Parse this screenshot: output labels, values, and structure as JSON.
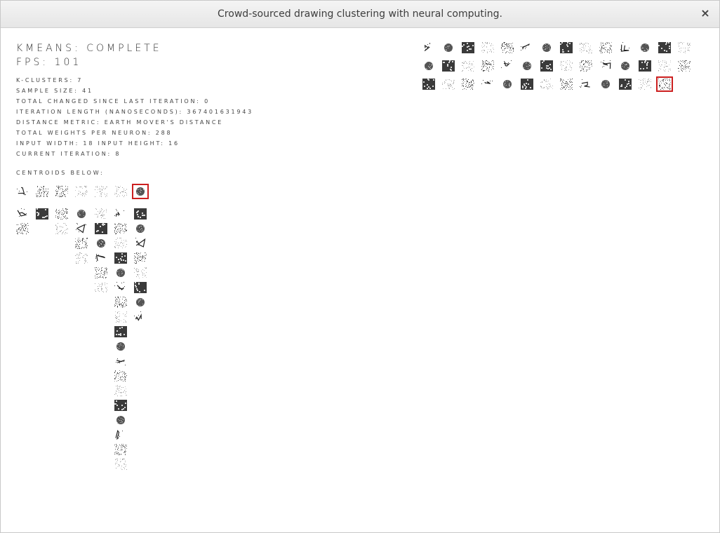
{
  "window": {
    "title": "Crowd-sourced drawing clustering with neural computing.",
    "close_icon": "×"
  },
  "status": {
    "state": "KMEANS: COMPLETE",
    "fps": "FPS: 101",
    "lines": [
      "K-CLUSTERS: 7",
      "SAMPLE SIZE: 41",
      "TOTAL CHANGED SINCE LAST ITERATION: 0",
      "ITERATION LENGTH (NANOSECONDS): 367401631943",
      "DISTANCE METRIC: EARTH MOVER'S DISTANCE",
      "TOTAL WEIGHTS PER NEURON: 288",
      "INPUT WIDTH: 18 INPUT HEIGHT: 16",
      "CURRENT ITERATION: 8"
    ],
    "centroids_label": "CENTROIDS BELOW:"
  },
  "colors": {
    "selected_outline": "#cc1f1f",
    "text": "#333333"
  }
}
